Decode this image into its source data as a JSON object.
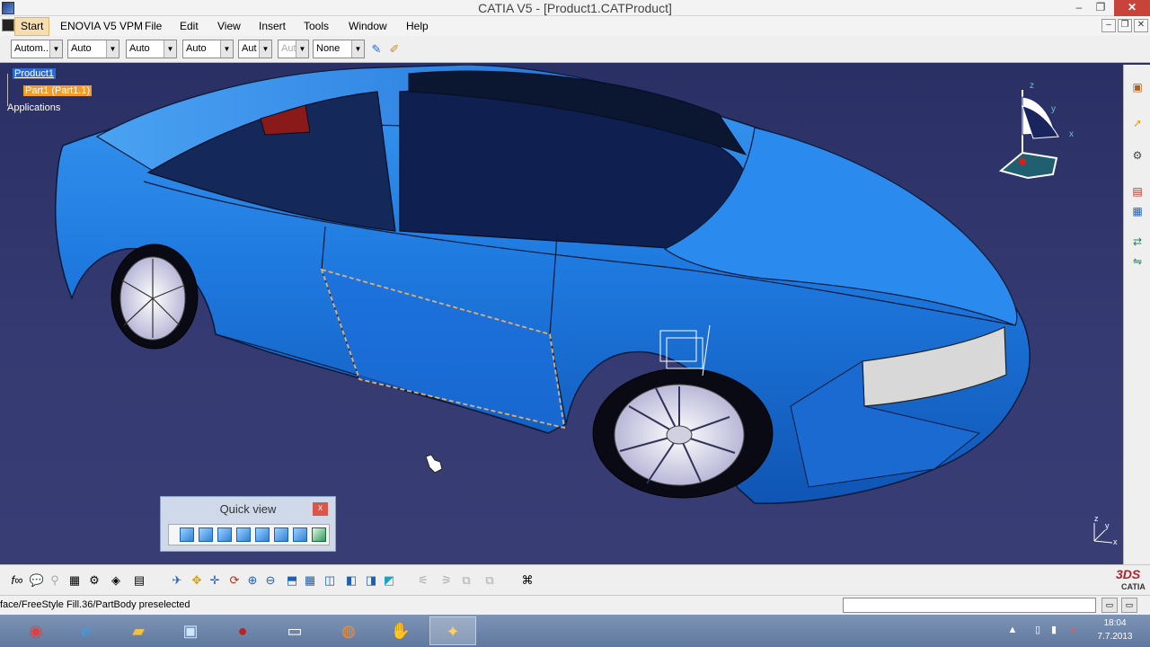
{
  "window": {
    "title": "CATIA V5 - [Product1.CATProduct]",
    "minimize": "–",
    "maximize": "❐",
    "close": "✕"
  },
  "menu": {
    "items": [
      "Start",
      "ENOVIA V5 VPM",
      "File",
      "Edit",
      "View",
      "Insert",
      "Tools",
      "Window",
      "Help"
    ],
    "mdi_min": "–",
    "mdi_restore": "❐",
    "mdi_close": "✕"
  },
  "toolbar": {
    "combos": [
      "Autom...",
      "Auto",
      "Auto",
      "Auto",
      "Aut",
      "Aut",
      "None"
    ]
  },
  "tree": {
    "root": "Product1",
    "part": "Part1 (Part1.1)",
    "applications": "Applications"
  },
  "compass": {
    "x": "x",
    "y": "y",
    "z": "z"
  },
  "mini_axis": {
    "x": "x",
    "y": "y",
    "z": "z"
  },
  "quick_view": {
    "title": "Quick view",
    "close": "x"
  },
  "status": {
    "message": "face/FreeStyle Fill.36/PartBody preselected",
    "command_value": ""
  },
  "brand": {
    "ds": "3DS",
    "name": "CATIA"
  },
  "taskbar": {
    "time": "18:04",
    "date": "7.7.2013"
  },
  "colors": {
    "car_body": "#1f7ae0",
    "background": "#2c3260",
    "selection_orange": "#f39c2a",
    "selection_blue": "#2c6bd0"
  }
}
